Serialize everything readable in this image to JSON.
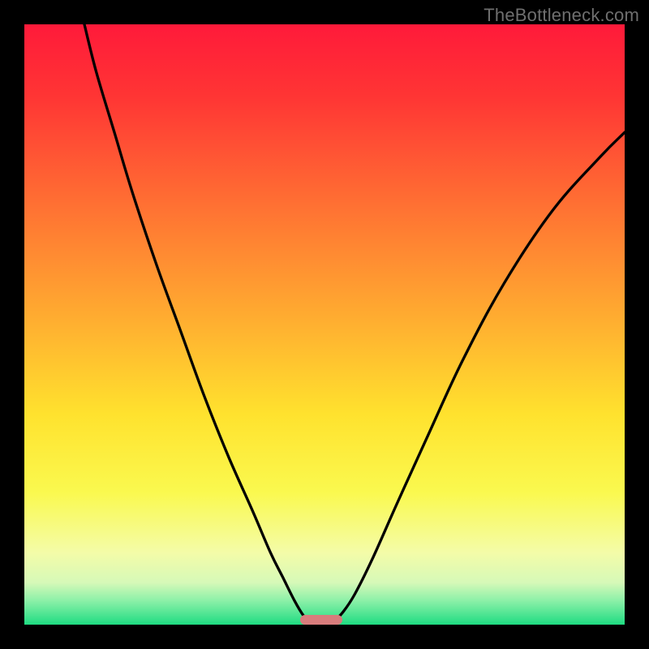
{
  "watermark": "TheBottleneck.com",
  "chart_data": {
    "type": "line",
    "title": "",
    "xlabel": "",
    "ylabel": "",
    "xlim": [
      0,
      100
    ],
    "ylim": [
      0,
      100
    ],
    "grid": false,
    "series": [
      {
        "name": "left-curve",
        "x": [
          10,
          12,
          15,
          18,
          22,
          26,
          30,
          34,
          38,
          41,
          43,
          45,
          46.5,
          47.5
        ],
        "y": [
          100,
          92,
          82,
          72,
          60,
          49,
          38,
          28,
          19,
          12,
          8,
          4,
          1.5,
          0.5
        ]
      },
      {
        "name": "right-curve",
        "x": [
          51.5,
          53,
          55,
          58,
          62,
          67,
          73,
          80,
          88,
          96,
          100
        ],
        "y": [
          0.5,
          2,
          5,
          11,
          20,
          31,
          44,
          57,
          69,
          78,
          82
        ]
      }
    ],
    "marker": {
      "name": "bottleneck-region",
      "x_start": 46,
      "x_end": 53,
      "y": 0
    },
    "gradient_stops": [
      {
        "pct": 0,
        "color": "#ff1a3a"
      },
      {
        "pct": 12,
        "color": "#ff3534"
      },
      {
        "pct": 30,
        "color": "#ff7033"
      },
      {
        "pct": 50,
        "color": "#ffb030"
      },
      {
        "pct": 65,
        "color": "#ffe22e"
      },
      {
        "pct": 78,
        "color": "#faf94f"
      },
      {
        "pct": 88,
        "color": "#f4fca8"
      },
      {
        "pct": 93,
        "color": "#d6f9b8"
      },
      {
        "pct": 96,
        "color": "#8cf0a8"
      },
      {
        "pct": 100,
        "color": "#1fdc82"
      }
    ]
  }
}
